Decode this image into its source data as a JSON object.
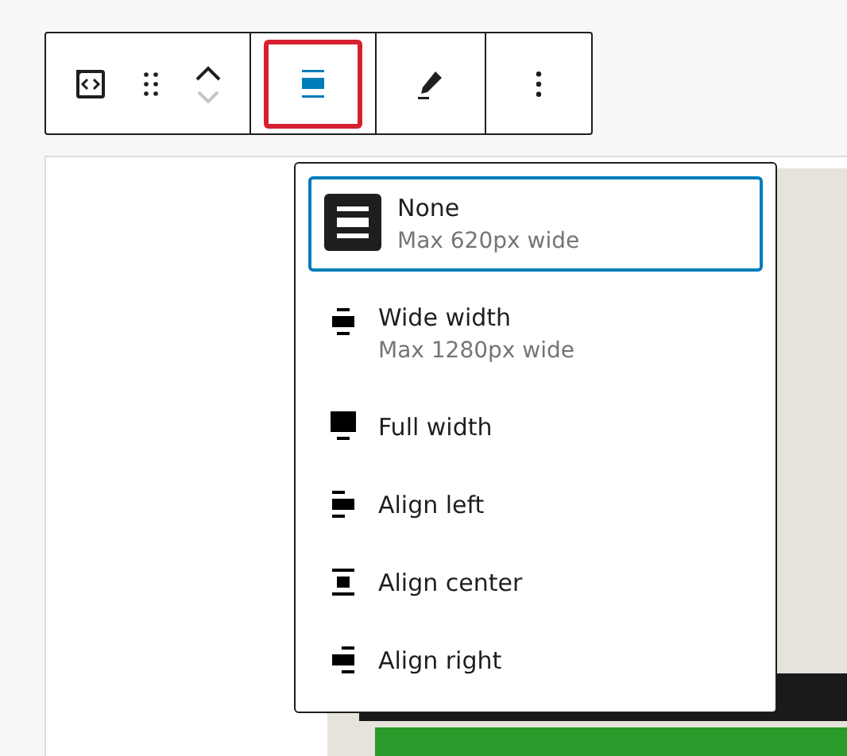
{
  "toolbar": {
    "groups": [
      {
        "items": [
          {
            "kind": "block_type",
            "selected": false
          },
          {
            "kind": "drag",
            "selected": false
          },
          {
            "kind": "movers",
            "up_disabled": false,
            "down_disabled": true
          }
        ]
      },
      {
        "items": [
          {
            "kind": "align",
            "selected": true
          }
        ]
      },
      {
        "items": [
          {
            "kind": "edit",
            "selected": false
          }
        ]
      },
      {
        "items": [
          {
            "kind": "more",
            "selected": false
          }
        ]
      }
    ]
  },
  "align_menu": {
    "items": [
      {
        "kind": "none",
        "label": "None",
        "description": "Max 620px wide",
        "selected": true
      },
      {
        "kind": "wide",
        "label": "Wide width",
        "description": "Max 1280px wide",
        "selected": false
      },
      {
        "kind": "full",
        "label": "Full width",
        "selected": false
      },
      {
        "kind": "left",
        "label": "Align left",
        "selected": false
      },
      {
        "kind": "center",
        "label": "Align center",
        "selected": false
      },
      {
        "kind": "right",
        "label": "Align right",
        "selected": false
      }
    ]
  }
}
